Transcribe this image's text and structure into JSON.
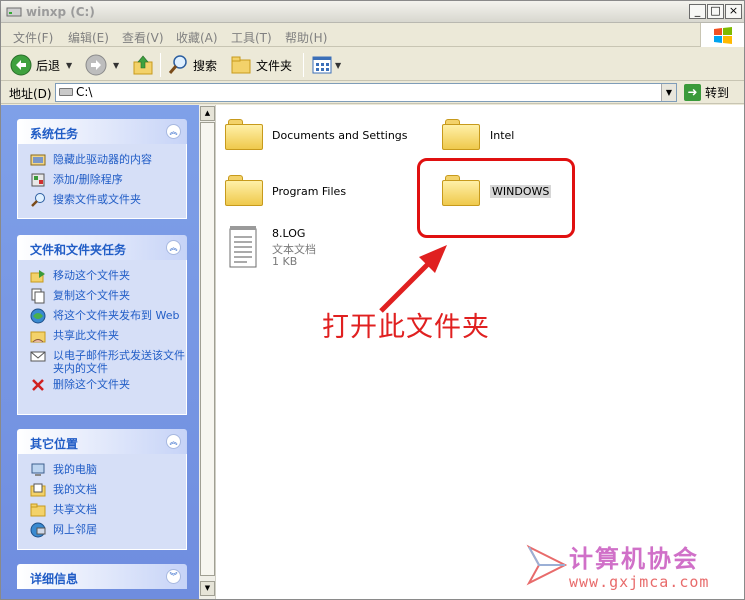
{
  "window": {
    "title": "winxp (C:)"
  },
  "menu": [
    "文件(F)",
    "编辑(E)",
    "查看(V)",
    "收藏(A)",
    "工具(T)",
    "帮助(H)"
  ],
  "toolbar": {
    "back": "后退",
    "search": "搜索",
    "folders": "文件夹"
  },
  "address": {
    "label": "地址(D)",
    "value": "C:\\",
    "go": "转到"
  },
  "taskpane": {
    "system_tasks": {
      "title": "系统任务",
      "items": [
        "隐藏此驱动器的内容",
        "添加/删除程序",
        "搜索文件或文件夹"
      ]
    },
    "file_tasks": {
      "title": "文件和文件夹任务",
      "items": [
        "移动这个文件夹",
        "复制这个文件夹",
        "将这个文件夹发布到 Web",
        "共享此文件夹",
        "以电子邮件形式发送该文件夹内的文件",
        "删除这个文件夹"
      ]
    },
    "other_places": {
      "title": "其它位置",
      "items": [
        "我的电脑",
        "我的文档",
        "共享文档",
        "网上邻居"
      ]
    },
    "details": {
      "title": "详细信息"
    }
  },
  "files": [
    {
      "name": "Documents and Settings",
      "type": "folder"
    },
    {
      "name": "Intel",
      "type": "folder"
    },
    {
      "name": "Program Files",
      "type": "folder"
    },
    {
      "name": "WINDOWS",
      "type": "folder"
    },
    {
      "name": "8.LOG",
      "type": "text",
      "kind": "文本文档",
      "size": "1 KB"
    }
  ],
  "annotation": {
    "text": "打开此文件夹"
  },
  "watermark": {
    "title": "计算机协会",
    "url": "www.gxjmca.com"
  },
  "colors": {
    "task_link": "#215dc6",
    "pane_bg": "#6f8ddf",
    "annotation": "#e02020"
  }
}
